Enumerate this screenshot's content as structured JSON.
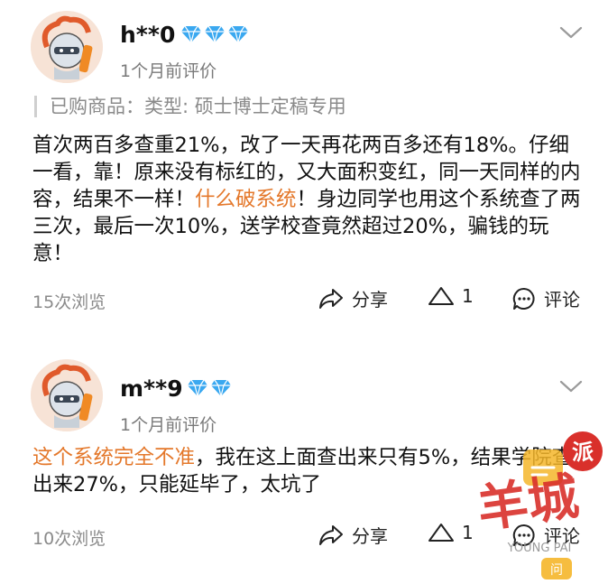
{
  "reviews": [
    {
      "username": "h**0",
      "diamond_count": 3,
      "time": "1个月前评价",
      "product_label": "已购商品：类型: 硕士博士定稿专用",
      "content_parts": [
        "首次两百多查重21%，改了一天再花两百多还有18%。仔细一看，靠！原来没有标红的，又大面积变红，同一天同样的内容，结果不一样！",
        "什么破系统",
        "！身边同学也用这个系统查了两三次，最后一次10%，送学校查竟然超过20%，骗钱的玩意！"
      ],
      "views": "15次浏览",
      "share_label": "分享",
      "like_count": "1",
      "comment_label": "评论"
    },
    {
      "username": "m**9",
      "diamond_count": 2,
      "time": "1个月前评价",
      "content_parts": [
        "这个系统完全不准",
        "，我在这上面查出来只有5%，结果学院查出来27%，只能延毕了，太坑了"
      ],
      "views": "10次浏览",
      "share_label": "分享",
      "like_count": "1",
      "comment_label": "评论"
    }
  ],
  "watermark": {
    "brand_text": "羊城",
    "badge_text": "派",
    "sub_text": "YOUNG PAI",
    "bubble_text": "问"
  },
  "colors": {
    "highlight": "#e4782b",
    "diamond": "#3aa8f0",
    "muted": "#8a8a8a",
    "watermark_red": "#d9302b",
    "watermark_yellow": "#f5b62a"
  },
  "icons": [
    "avatar-mascot",
    "diamond-icon",
    "chevron-down-icon",
    "share-icon",
    "like-triangle-icon",
    "comment-bubble-icon"
  ]
}
